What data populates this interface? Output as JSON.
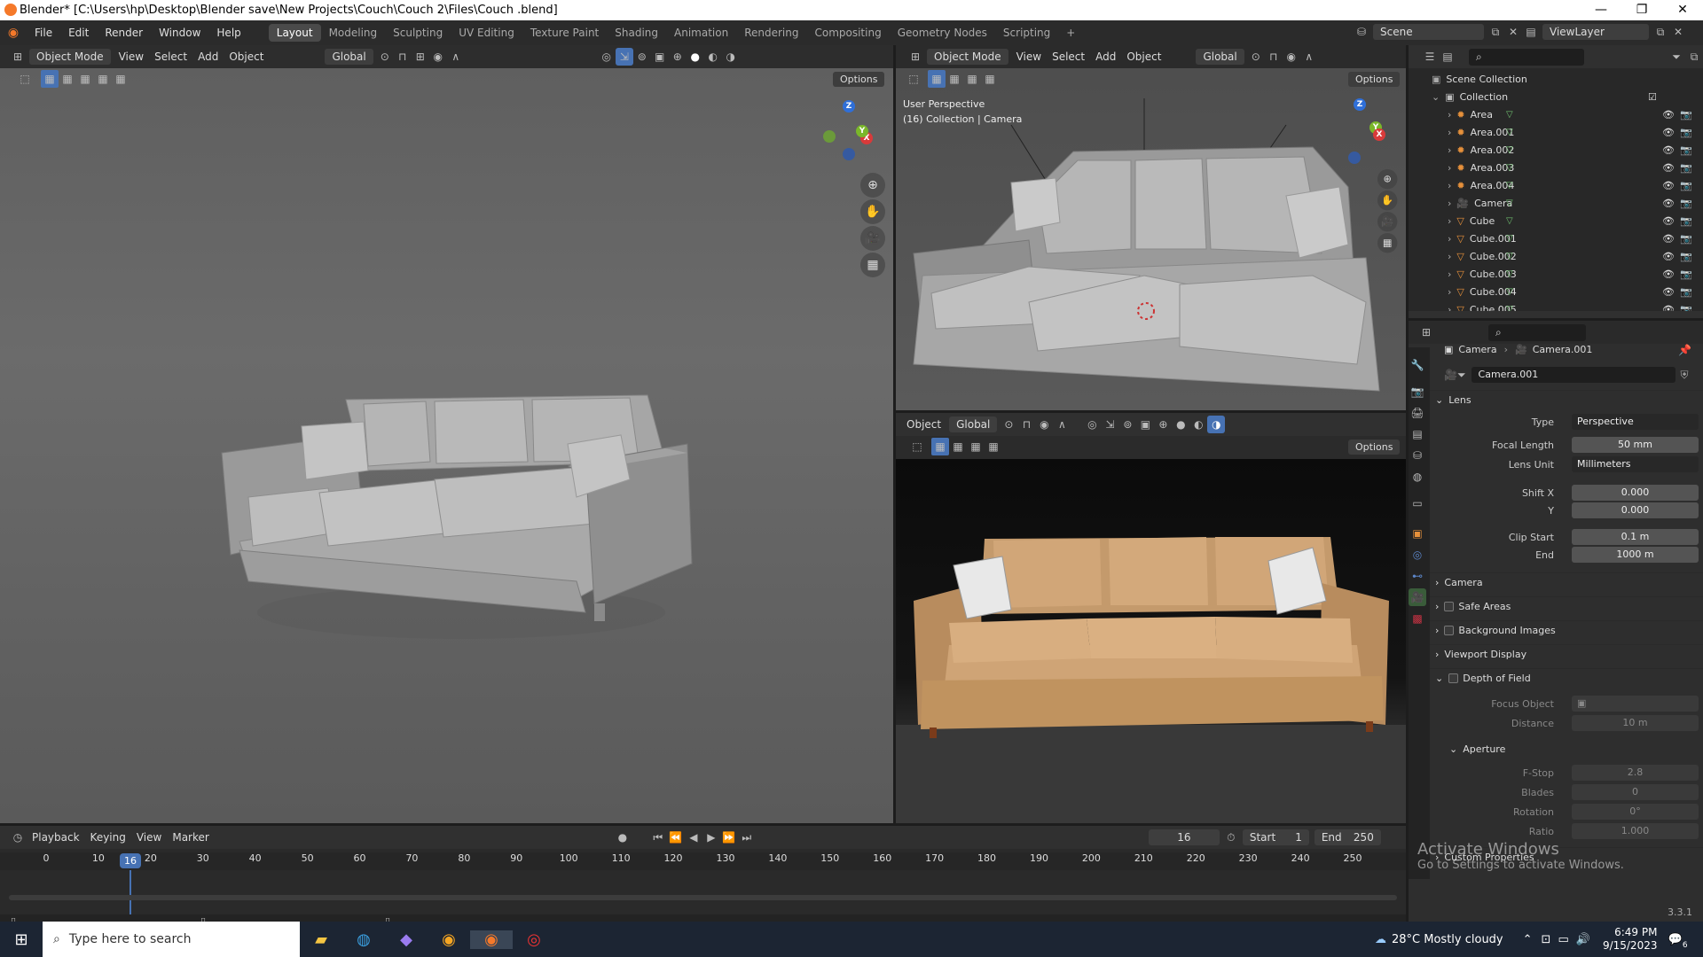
{
  "window": {
    "title": "Blender* [C:\\Users\\hp\\Desktop\\Blender save\\New Projects\\Couch\\Couch 2\\Files\\Couch .blend]",
    "min": "—",
    "max": "❐",
    "close": "✕"
  },
  "menus": [
    "File",
    "Edit",
    "Render",
    "Window",
    "Help"
  ],
  "workspaces": [
    "Layout",
    "Modeling",
    "Sculpting",
    "UV Editing",
    "Texture Paint",
    "Shading",
    "Animation",
    "Rendering",
    "Compositing",
    "Geometry Nodes",
    "Scripting",
    "+"
  ],
  "scene": {
    "label": "Scene",
    "view_layer": "ViewLayer"
  },
  "viewport_left": {
    "mode": "Object Mode",
    "menus": [
      "View",
      "Select",
      "Add",
      "Object"
    ],
    "orientation": "Global",
    "options": "Options"
  },
  "viewport_right": {
    "mode": "Object Mode",
    "menus": [
      "View",
      "Select",
      "Add",
      "Object"
    ],
    "orientation": "Global",
    "options": "Options",
    "perspective": "User Perspective",
    "collection": "(16) Collection | Camera"
  },
  "render_view": {
    "menu": "Object",
    "orientation": "Global",
    "options": "Options"
  },
  "outliner": {
    "root": "Scene Collection",
    "collection": "Collection",
    "items": [
      "Area",
      "Area.001",
      "Area.002",
      "Area.003",
      "Area.004",
      "Camera",
      "Cube",
      "Cube.001",
      "Cube.002",
      "Cube.003",
      "Cube.004",
      "Cube.005"
    ]
  },
  "properties": {
    "breadcrumb_obj": "Camera",
    "breadcrumb_data": "Camera.001",
    "datablock": "Camera.001",
    "lens_section": "Lens",
    "type_label": "Type",
    "type_value": "Perspective",
    "focal_label": "Focal Length",
    "focal_value": "50 mm",
    "unit_label": "Lens Unit",
    "unit_value": "Millimeters",
    "shiftx_label": "Shift X",
    "shiftx_value": "0.000",
    "shifty_label": "Y",
    "shifty_value": "0.000",
    "clipstart_label": "Clip Start",
    "clipstart_value": "0.1 m",
    "clipend_label": "End",
    "clipend_value": "1000 m",
    "sections": [
      "Camera",
      "Safe Areas",
      "Background Images",
      "Viewport Display",
      "Depth of Field"
    ],
    "focus_label": "Focus Object",
    "distance_label": "Distance",
    "distance_value": "10 m",
    "aperture": "Aperture",
    "fstop_label": "F-Stop",
    "fstop_value": "2.8",
    "blades_label": "Blades",
    "blades_value": "0",
    "rotation_label": "Rotation",
    "rotation_value": "0°",
    "ratio_label": "Ratio",
    "ratio_value": "1.000",
    "custom": "Custom Properties"
  },
  "timeline": {
    "menus": [
      "Playback",
      "Keying",
      "View",
      "Marker"
    ],
    "current_frame": "16",
    "start_label": "Start",
    "start": "1",
    "end_label": "End",
    "end": "250",
    "ticks": [
      "0",
      "10",
      "20",
      "30",
      "40",
      "50",
      "60",
      "70",
      "80",
      "90",
      "100",
      "110",
      "120",
      "130",
      "140",
      "150",
      "160",
      "170",
      "180",
      "190",
      "200",
      "210",
      "220",
      "230",
      "240",
      "250"
    ],
    "playhead": "16"
  },
  "watermark": {
    "line1": "Activate Windows",
    "line2": "Go to Settings to activate Windows."
  },
  "version": "3.3.1",
  "taskbar": {
    "search": "Type here to search",
    "weather": "28°C  Mostly cloudy",
    "time": "6:49 PM",
    "date": "9/15/2023",
    "notif": "6"
  }
}
